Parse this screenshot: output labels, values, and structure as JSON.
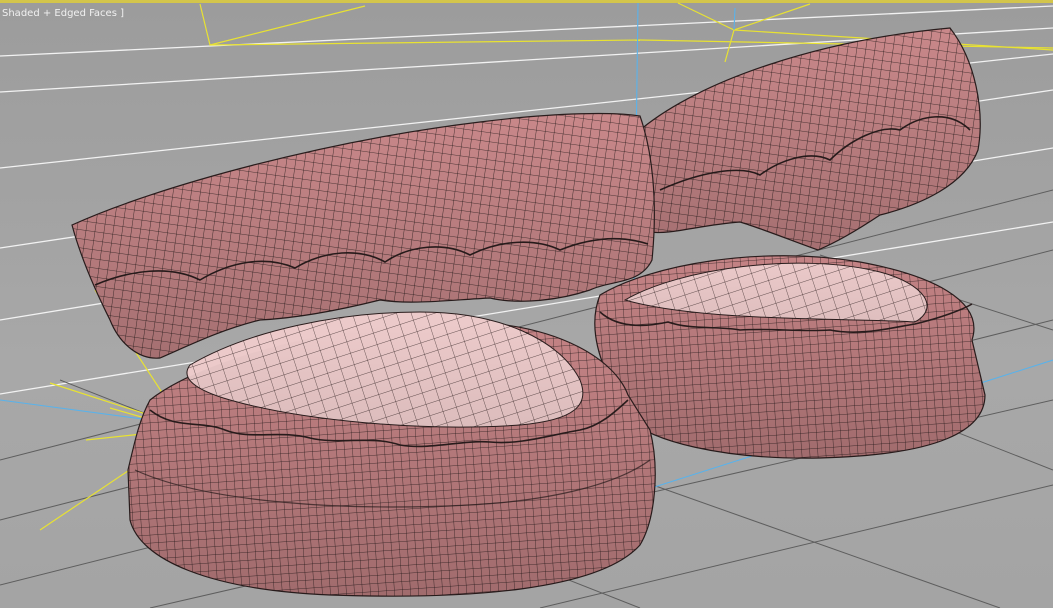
{
  "viewport": {
    "label": "Shaded + Edged Faces ]",
    "background": "#a3a3a3",
    "grid_color": "#f2f2f2",
    "selection_color": "#e8e232",
    "light_line_color": "#5ab2ea"
  },
  "model": {
    "skin_color": "#c9888a",
    "palate_color": "#e9c4c4",
    "wire_color": "#2a1d1d"
  }
}
